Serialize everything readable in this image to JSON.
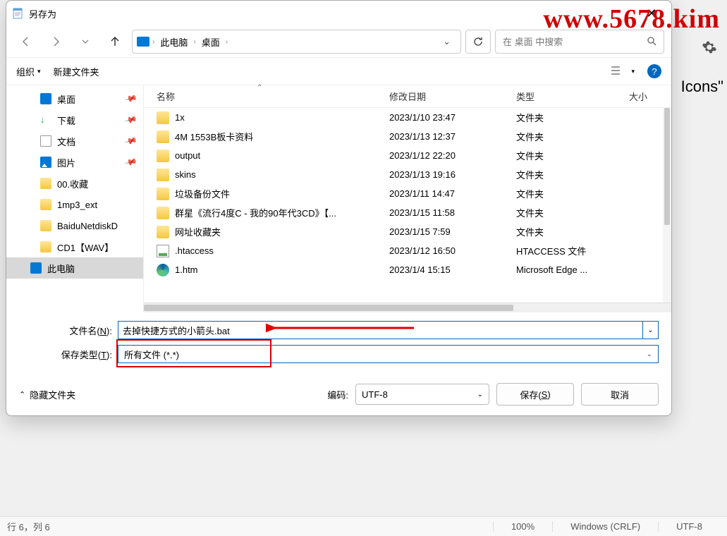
{
  "watermark": "www.5678.kim",
  "bg_text": "Icons\"",
  "dialog": {
    "title": "另存为",
    "nav": {
      "crumb1": "此电脑",
      "crumb2": "桌面"
    },
    "search_placeholder": "在 桌面 中搜索",
    "toolbar": {
      "organize": "组织",
      "new_folder": "新建文件夹"
    },
    "sidebar": [
      {
        "icon": "desk",
        "label": "桌面",
        "pinned": true
      },
      {
        "icon": "down",
        "label": "下载",
        "pinned": true,
        "glyph": "↓"
      },
      {
        "icon": "doc",
        "label": "文档",
        "pinned": true
      },
      {
        "icon": "pic",
        "label": "图片",
        "pinned": true
      },
      {
        "icon": "fold",
        "label": "00.收藏",
        "pinned": false
      },
      {
        "icon": "fold",
        "label": "1mp3_ext",
        "pinned": false
      },
      {
        "icon": "fold",
        "label": "BaiduNetdiskD",
        "pinned": false
      },
      {
        "icon": "fold",
        "label": "CD1【WAV】",
        "pinned": false
      },
      {
        "icon": "pc",
        "label": "此电脑",
        "pinned": false,
        "selected": true
      }
    ],
    "columns": {
      "name": "名称",
      "date": "修改日期",
      "type": "类型",
      "size": "大小"
    },
    "files": [
      {
        "icon": "folder",
        "name": "1x",
        "date": "2023/1/10 23:47",
        "type": "文件夹"
      },
      {
        "icon": "folder",
        "name": "4M 1553B板卡资料",
        "date": "2023/1/13 12:37",
        "type": "文件夹"
      },
      {
        "icon": "folder",
        "name": "output",
        "date": "2023/1/12 22:20",
        "type": "文件夹"
      },
      {
        "icon": "folder",
        "name": "skins",
        "date": "2023/1/13 19:16",
        "type": "文件夹"
      },
      {
        "icon": "folder",
        "name": "垃圾备份文件",
        "date": "2023/1/11 14:47",
        "type": "文件夹"
      },
      {
        "icon": "folder",
        "name": "群星《流行4度C - 我的90年代3CD》【...",
        "date": "2023/1/15 11:58",
        "type": "文件夹"
      },
      {
        "icon": "folder",
        "name": "网址收藏夹",
        "date": "2023/1/15 7:59",
        "type": "文件夹"
      },
      {
        "icon": "file-h",
        "name": ".htaccess",
        "date": "2023/1/12 16:50",
        "type": "HTACCESS 文件"
      },
      {
        "icon": "edge",
        "name": "1.htm",
        "date": "2023/1/4 15:15",
        "type": "Microsoft Edge ..."
      }
    ],
    "filename_label": "文件名(N):",
    "filename_value": "去掉快捷方式的小箭头.bat",
    "filetype_label": "保存类型(T):",
    "filetype_value": "所有文件 (*.*)",
    "hide_folders": "隐藏文件夹",
    "encoding_label": "编码:",
    "encoding_value": "UTF-8",
    "save_btn": "保存(S)",
    "cancel_btn": "取消"
  },
  "statusbar": {
    "pos": "行 6，列 6",
    "zoom": "100%",
    "eol": "Windows (CRLF)",
    "enc": "UTF-8"
  }
}
